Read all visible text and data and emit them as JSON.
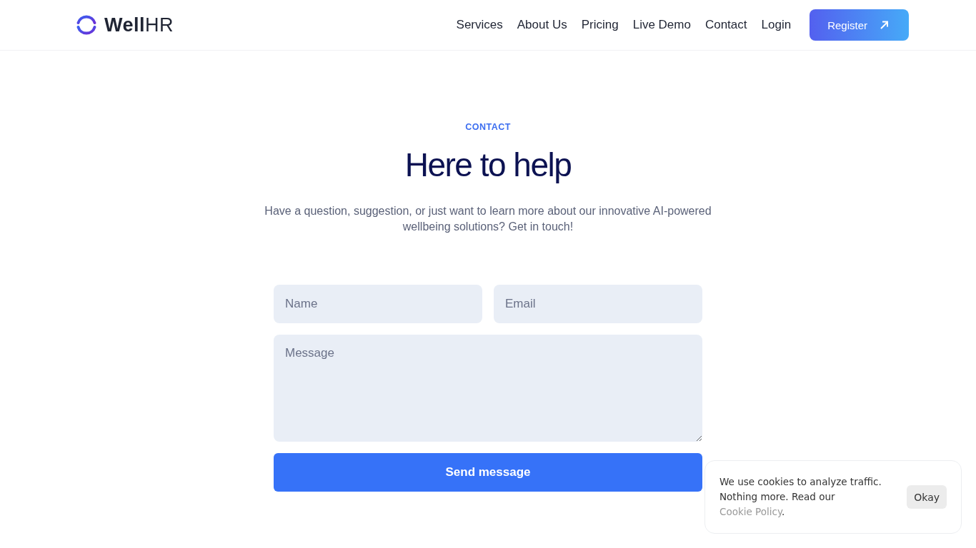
{
  "header": {
    "logo": "**Well**HR",
    "nav": [
      "Services",
      "About Us",
      "Pricing",
      "Live Demo",
      "Contact",
      "Login"
    ],
    "cta": {
      "label": "Register"
    }
  },
  "contact": {
    "eyebrow": "CONTACT",
    "title": "Here to help",
    "description": "Have a question, suggestion, or just want to learn more about our innovative AI-powered wellbeing solutions? Get in touch!",
    "fields": [
      {
        "kind": "input",
        "placeholder": "Name"
      },
      {
        "kind": "input",
        "placeholder": "Email"
      },
      {
        "kind": "textarea",
        "placeholder": "Message"
      }
    ],
    "submit": "Send message"
  },
  "cookie_banner": {
    "text": "We use cookies to analyze traffic. Nothing more. Read our",
    "link": "Cookie Policy",
    "end": ".",
    "button": "Okay"
  }
}
